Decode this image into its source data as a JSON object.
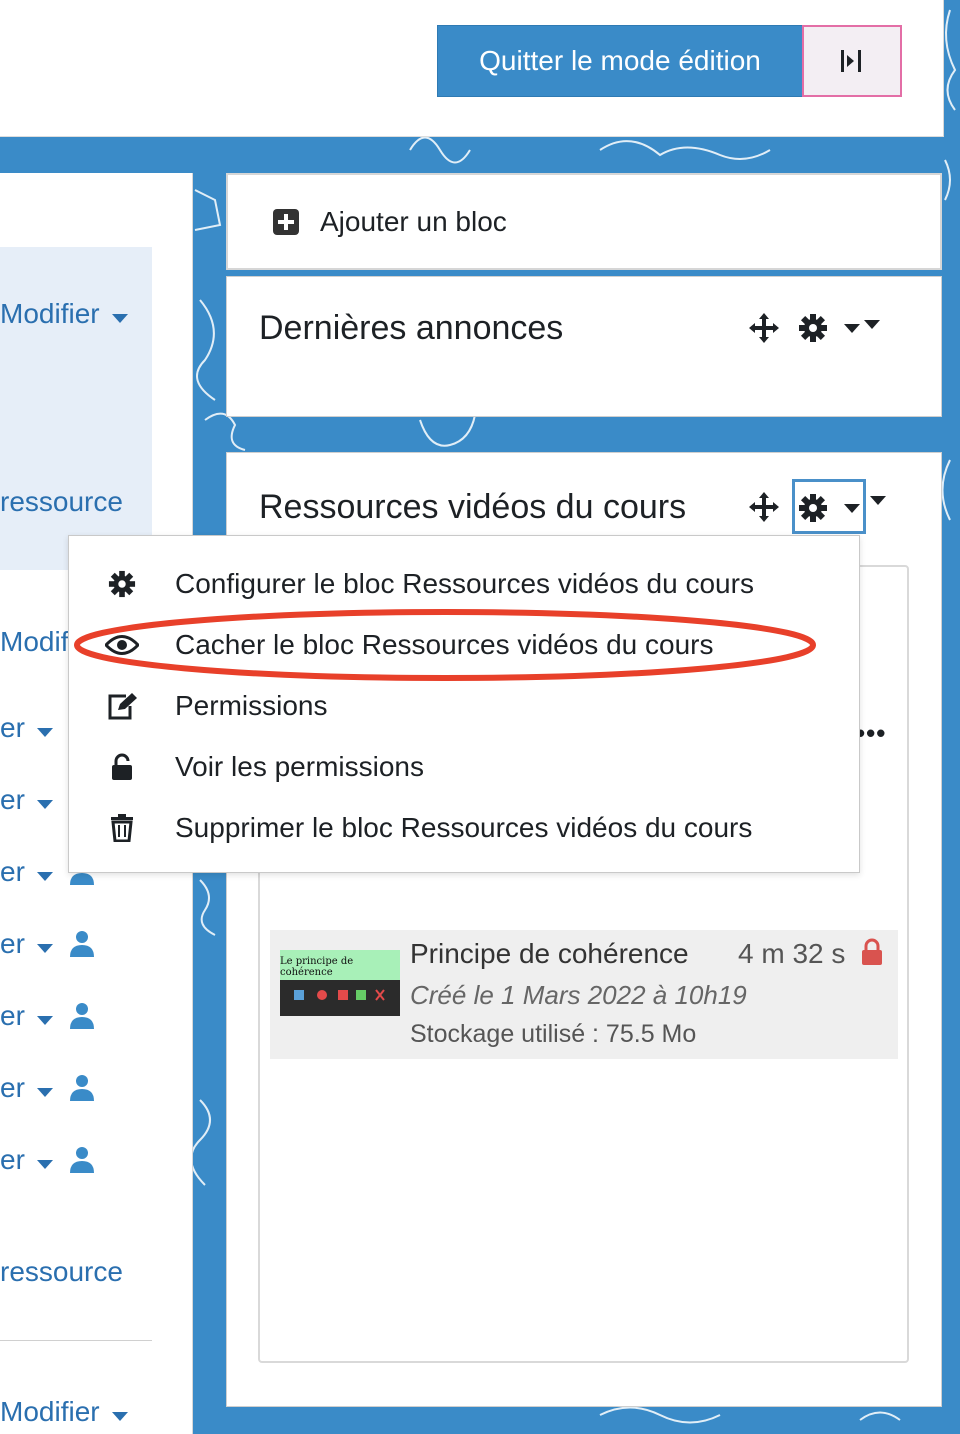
{
  "header": {
    "quit_edit_label": "Quitter le mode édition",
    "drawer_icon": "toggle-drawer-icon"
  },
  "left_column": {
    "edit_link": "Modifier",
    "edit_partial": "Modif",
    "resource_partial": "ressource",
    "edit_fragment": "er",
    "bottom_edit_link": "Modifier"
  },
  "add_block": {
    "icon": "plus-square-icon",
    "label": "Ajouter un bloc"
  },
  "announcements_block": {
    "title": "Dernières annonces"
  },
  "video_block": {
    "title": "Ressources vidéos du cours",
    "more_icon": "ellipsis-icon"
  },
  "block_menu": {
    "items": [
      {
        "icon": "gear-icon",
        "label": "Configurer le bloc Ressources vidéos du cours"
      },
      {
        "icon": "eye-icon",
        "label": "Cacher le bloc Ressources vidéos du cours"
      },
      {
        "icon": "edit-icon",
        "label": "Permissions"
      },
      {
        "icon": "unlock-icon",
        "label": "Voir les permissions"
      },
      {
        "icon": "trash-icon",
        "label": "Supprimer le bloc Ressources vidéos du cours"
      }
    ],
    "highlighted_item_index": 1,
    "highlight_color": "#e8402a"
  },
  "video_item": {
    "title": "Principe de cohérence",
    "duration": "4 m 32 s",
    "created": "Créé le 1 Mars 2022 à 10h19",
    "storage": "Stockage utilisé : 75.5 Mo",
    "thumbnail_title": "Le principe de cohérence",
    "lock_color": "#d9534f"
  },
  "colors": {
    "accent": "#3a8bc8",
    "link": "#2a6faf",
    "section_bg": "#e6eef8"
  }
}
